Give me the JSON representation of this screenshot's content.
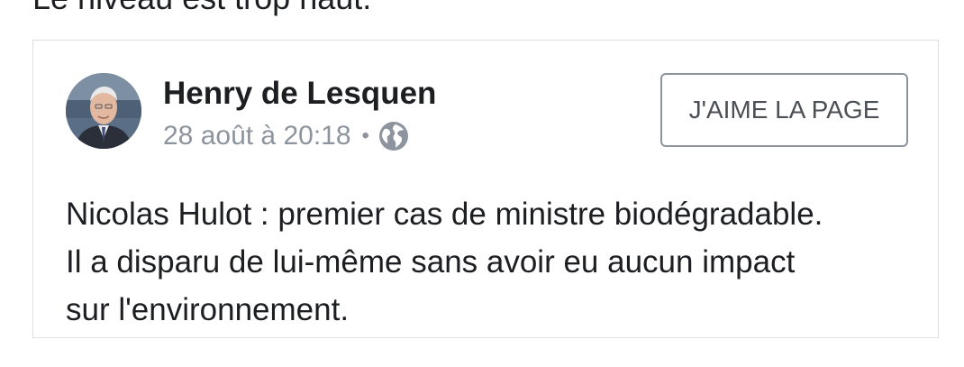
{
  "context_text": "Le niveau est trop haut.",
  "post": {
    "author": "Henry de Lesquen",
    "timestamp": "28 août à 20:18",
    "separator": "•",
    "audience_icon": "globe-icon",
    "like_page_button": "J'AIME LA PAGE",
    "text_lines": [
      "Nicolas Hulot : premier cas de ministre biodégradable.",
      "Il a disparu de lui-même sans avoir eu aucun impact",
      "sur l'environnement."
    ]
  },
  "colors": {
    "text": "#1c1e21",
    "secondary_text": "#8d949e",
    "border": "#dddfe2",
    "button_border": "#8d949e"
  }
}
